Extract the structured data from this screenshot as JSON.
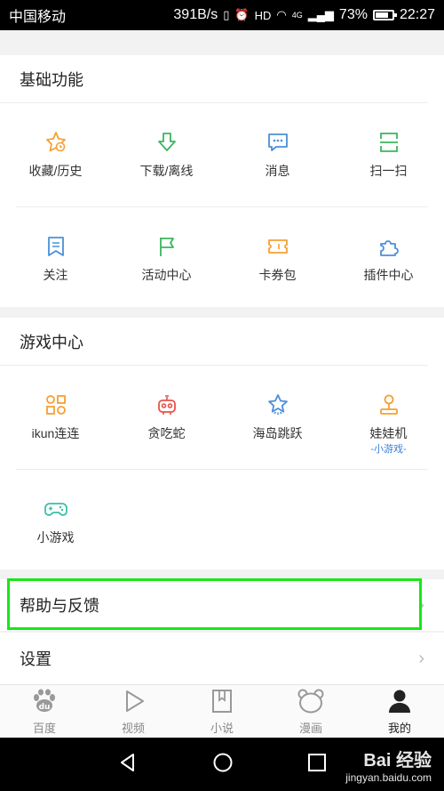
{
  "status_bar": {
    "carrier": "中国移动",
    "speed": "391B/s",
    "network": "4G",
    "battery": "73%",
    "time": "22:27"
  },
  "basic": {
    "title": "基础功能",
    "items": [
      {
        "label": "收藏/历史",
        "icon": "star-clock-icon"
      },
      {
        "label": "下载/离线",
        "icon": "download-icon"
      },
      {
        "label": "消息",
        "icon": "message-icon"
      },
      {
        "label": "扫一扫",
        "icon": "scan-icon"
      },
      {
        "label": "关注",
        "icon": "bookmark-icon"
      },
      {
        "label": "活动中心",
        "icon": "flag-icon"
      },
      {
        "label": "卡券包",
        "icon": "ticket-icon"
      },
      {
        "label": "插件中心",
        "icon": "puzzle-icon"
      }
    ]
  },
  "games": {
    "title": "游戏中心",
    "items": [
      {
        "label": "ikun连连",
        "icon": "grid-dots-icon"
      },
      {
        "label": "贪吃蛇",
        "icon": "robot-icon"
      },
      {
        "label": "海岛跳跃",
        "icon": "star-jump-icon"
      },
      {
        "label": "娃娃机",
        "icon": "joystick-icon",
        "sub": "-小游戏-"
      },
      {
        "label": "小游戏",
        "icon": "gamepad-icon"
      }
    ]
  },
  "help": {
    "label": "帮助与反馈"
  },
  "settings": {
    "label": "设置"
  },
  "tabs": [
    {
      "label": "百度",
      "icon": "baidu-paw-icon"
    },
    {
      "label": "视频",
      "icon": "play-icon"
    },
    {
      "label": "小说",
      "icon": "book-icon"
    },
    {
      "label": "漫画",
      "icon": "bear-icon"
    },
    {
      "label": "我的",
      "icon": "person-icon"
    }
  ],
  "watermark": {
    "brand": "Bai 经验",
    "url": "jingyan.baidu.com"
  },
  "colors": {
    "orange": "#f5a033",
    "green": "#3bb55f",
    "blue": "#4a90d9",
    "red": "#e8524a",
    "highlight": "#19e619"
  }
}
